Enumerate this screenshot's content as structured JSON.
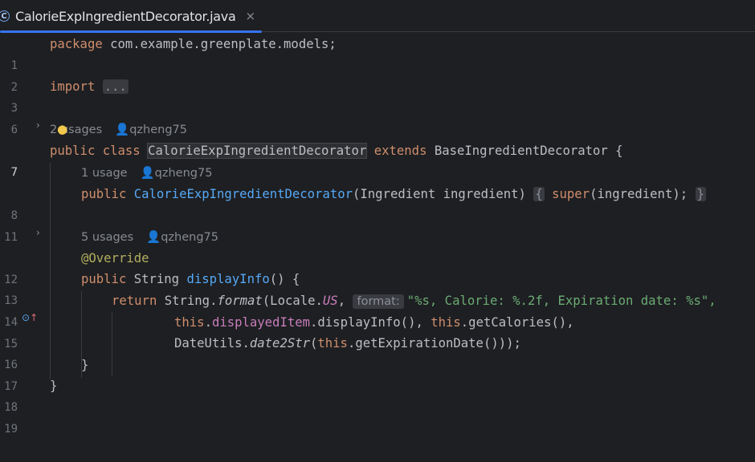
{
  "tab": {
    "icon_letter": "C",
    "file_name": "CalorieExpIngredientDecorator.java",
    "close_glyph": "×"
  },
  "colors": {
    "background": "#1e1f22",
    "keyword": "#cf8e6d",
    "method": "#56a8f5",
    "string": "#6aab73",
    "annotation": "#b3ae60",
    "field": "#c77dbb",
    "accent": "#3574f0"
  },
  "gutter": {
    "line_numbers": [
      "1",
      "2",
      "3",
      "6",
      "7",
      "8",
      "11",
      "12",
      "13",
      "14",
      "15",
      "16",
      "17",
      "18",
      "19"
    ],
    "override_icon": "override-marker-icon"
  },
  "inlays": {
    "class_usages": "2 usages",
    "class_author": "qzheng75",
    "ctor_usages": "1 usage",
    "ctor_author": "qzheng75",
    "method_usages": "5 usages",
    "method_author": "qzheng75"
  },
  "code": {
    "l1_kw": "package",
    "l1_rest": " com.example.greenplate.models;",
    "l3_kw": "import",
    "l3_fold": "...",
    "l7_public": "public",
    "l7_class": "class",
    "l7_name": "CalorieExpIngredientDecorator",
    "l7_extends": "extends",
    "l7_base": "BaseIngredientDecorator {",
    "l8_public": "public",
    "l8_ctor": "CalorieExpIngredientDecorator",
    "l8_params": "(Ingredient ingredient)",
    "l8_open": "{",
    "l8_super": "super",
    "l8_args": "(ingredient);",
    "l8_close": "}",
    "l12_ann": "@Override",
    "l13_public": "public",
    "l13_type": "String",
    "l13_name": "displayInfo",
    "l13_rest": "() {",
    "l14_return": "return",
    "l14_string": "String.",
    "l14_format": "format",
    "l14_locale": "(Locale.",
    "l14_us": "US",
    "l14_comma": ",",
    "l14_hint": "format:",
    "l14_str": "\"%s, Calorie: %.2f, Expiration date: %s\",",
    "l15_this1": "this",
    "l15_dot1": ".",
    "l15_field": "displayedItem",
    "l15_call1": ".displayInfo(), ",
    "l15_this2": "this",
    "l15_call2": ".getCalories(),",
    "l16_utils": "DateUtils.",
    "l16_fn": "date2Str",
    "l16_open": "(",
    "l16_this": "this",
    "l16_rest": ".getExpirationDate()));",
    "l17_close": "}",
    "l18_close": "}"
  }
}
